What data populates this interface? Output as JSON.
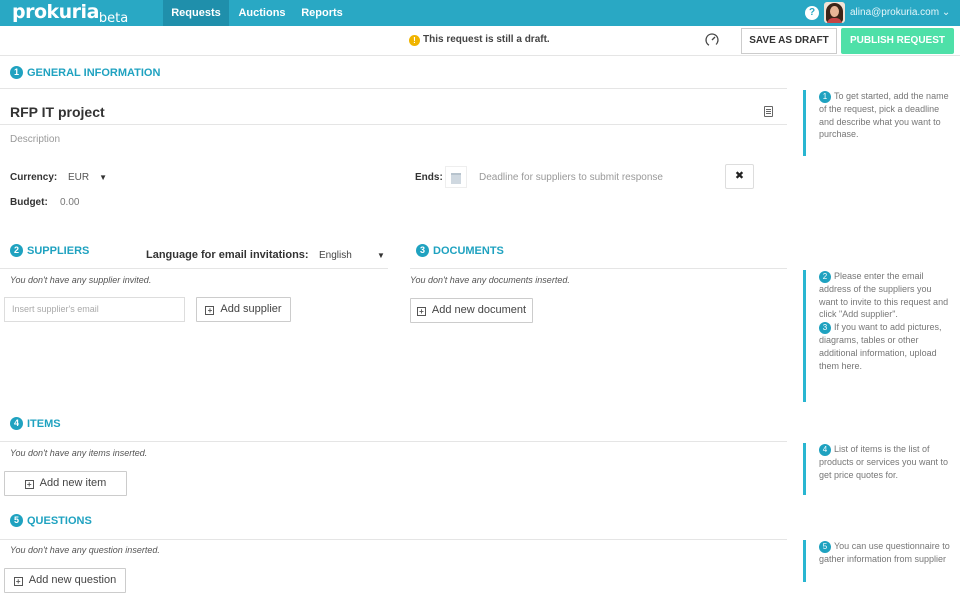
{
  "app": {
    "logo": "prokuria",
    "logo_suffix": "beta",
    "nav": [
      {
        "label": "Requests",
        "active": true
      },
      {
        "label": "Auctions",
        "active": false
      },
      {
        "label": "Reports",
        "active": false
      }
    ],
    "help_glyph": "?",
    "user_email": "alina@prokuria.com",
    "user_caret": "⌄"
  },
  "draft_bar": {
    "warning_icon": "info-warning-icon",
    "warning_glyph": "!",
    "message": "This request is still a draft.",
    "save_label": "SAVE AS DRAFT",
    "publish_label": "PUBLISH REQUEST",
    "publish_color": "#4ee0a8"
  },
  "general": {
    "number": "1",
    "title": "GENERAL INFORMATION",
    "project_name": "RFP IT project",
    "description_placeholder": "Description",
    "currency_label": "Currency:",
    "currency_value": "EUR",
    "currency_caret": "▼",
    "budget_label": "Budget:",
    "budget_value": "0.00",
    "ends_label": "Ends:",
    "deadline_placeholder": "Deadline for suppliers to submit response",
    "clear_glyph": "✖"
  },
  "suppliers": {
    "number": "2",
    "title": "SUPPLIERS",
    "language_label": "Language for email invitations:",
    "language_value": "English",
    "language_caret": "▼",
    "empty_text": "You don't have any supplier invited.",
    "email_placeholder": "Insert supplier's email",
    "add_label": "Add supplier"
  },
  "documents": {
    "number": "3",
    "title": "DOCUMENTS",
    "empty_text": "You don't have any documents inserted.",
    "add_label": "Add new document"
  },
  "items": {
    "number": "4",
    "title": "ITEMS",
    "empty_text": "You don't have any items inserted.",
    "add_label": "Add new item"
  },
  "questions": {
    "number": "5",
    "title": "QUESTIONS",
    "empty_text": "You don't have any question inserted.",
    "add_label": "Add new question"
  },
  "plus_glyph": "+",
  "help": {
    "step1_num": "1",
    "step1": "To get started, add the name of the request, pick a deadline and describe what you want to purchase.",
    "step2_num": "2",
    "step2": "Please enter the email address of the suppliers you want to invite to this request and click \"Add supplier\".",
    "step3_num": "3",
    "step3": "If you want to add pictures, diagrams, tables or other additional information, upload them here.",
    "step4_num": "4",
    "step4": "List of items is the list of products or services you want to get price quotes for.",
    "step5_num": "5",
    "step5": "You can use questionnaire to gather information from supplier"
  },
  "colors": {
    "nav_bar": "#29a8c4",
    "accent": "#1fa2c0",
    "publish": "#4ee0a8",
    "warning": "#f0b400"
  }
}
